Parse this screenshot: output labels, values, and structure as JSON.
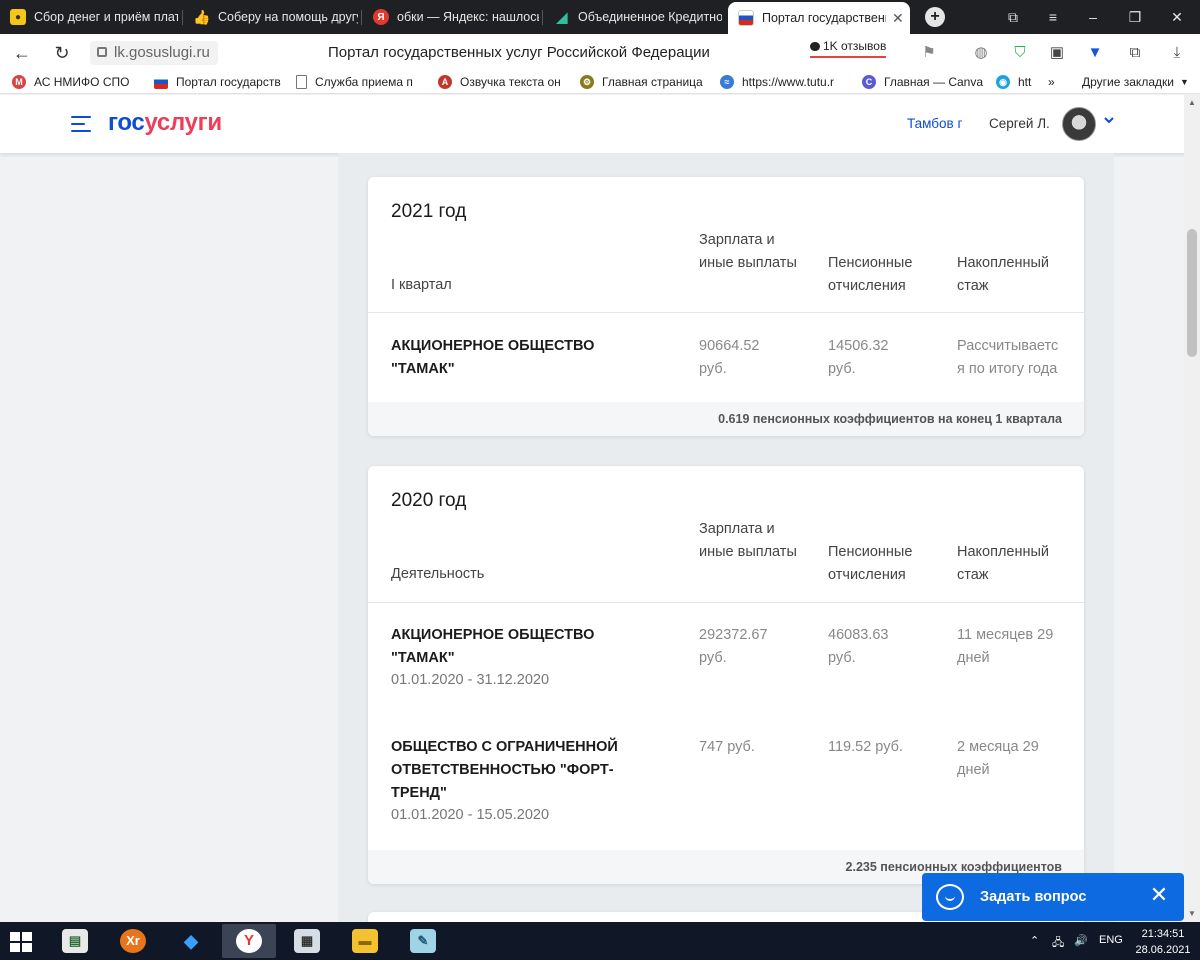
{
  "browser": {
    "tabs": [
      {
        "title": "Сбор денег и приём плат",
        "icon": "yellow-badge-icon",
        "color": "#f5c518"
      },
      {
        "title": "Соберу на помощь другу",
        "icon": "thumbs-up-icon",
        "color": "#f5c518"
      },
      {
        "title": "обки — Яндекс: нашлось",
        "icon": "yandex-icon",
        "color": "#e03a2e"
      },
      {
        "title": "Объединенное Кредитно",
        "icon": "okb-icon",
        "color": "#2fbfa0"
      },
      {
        "title": "Портал государственн",
        "icon": "russia-flag-icon",
        "color": "#1c56c6",
        "active": true
      }
    ],
    "url": "lk.gosuslugi.ru",
    "page_title": "Портал государственных услуг Российской Федерации",
    "reviews": "1K отзывов",
    "bookmarks": [
      "АС НМИФО СПО",
      "Портал государств",
      "Служба приема п",
      "Озвучка текста он",
      "Главная страница",
      "https://www.tutu.r",
      "Главная — Canva",
      "htt"
    ],
    "other_bookmarks": "Другие закладки"
  },
  "site": {
    "logo_part1": "гос",
    "logo_part2": "услуги",
    "brand_blue": "#0d4cd3",
    "brand_red": "#ee3f58",
    "region": "Тамбов г",
    "user": "Сергей Л."
  },
  "cards": [
    {
      "year": "2021 год",
      "period_label": "I квартал",
      "columns": {
        "salary": "Зарплата и иные выплаты",
        "pension": "Пенсионные отчисления",
        "experience": "Накопленный стаж"
      },
      "rows": [
        {
          "org": "АКЦИОНЕРНОЕ ОБЩЕСТВО \"ТАМАК\"",
          "dates": "",
          "salary": "90664.52 руб.",
          "pension": "14506.32 руб.",
          "experience": "Рассчитывается по итогу года"
        }
      ],
      "footer": "0.619 пенсионных коэффициентов на конец 1 квартала"
    },
    {
      "year": "2020 год",
      "period_label": "Деятельность",
      "columns": {
        "salary": "Зарплата и иные выплаты",
        "pension": "Пенсионные отчисления",
        "experience": "Накопленный стаж"
      },
      "rows": [
        {
          "org": "АКЦИОНЕРНОЕ ОБЩЕСТВО \"ТАМАК\"",
          "dates": "01.01.2020 - 31.12.2020",
          "salary": "292372.67 руб.",
          "pension": "46083.63 руб.",
          "experience": "11 месяцев 29 дней"
        },
        {
          "org": "ОБЩЕСТВО С ОГРАНИЧЕННОЙ ОТВЕТСТВЕННОСТЬЮ \"ФОРТ-ТРЕНД\"",
          "dates": "01.01.2020 - 15.05.2020",
          "salary": "747 руб.",
          "pension": "119.52 руб.",
          "experience": "2 месяца 29 дней"
        }
      ],
      "footer": "2.235 пенсионных коэффициентов"
    }
  ],
  "chat": {
    "label": "Задать вопрос",
    "color": "#0d6ae0"
  },
  "taskbar": {
    "apps": [
      "file-explorer-icon",
      "xr-icon",
      "gem-icon",
      "yandex-browser-icon",
      "calculator-icon",
      "folder-icon",
      "notepad-icon"
    ],
    "lang": "ENG",
    "time": "21:34:51",
    "date": "28.06.2021"
  }
}
